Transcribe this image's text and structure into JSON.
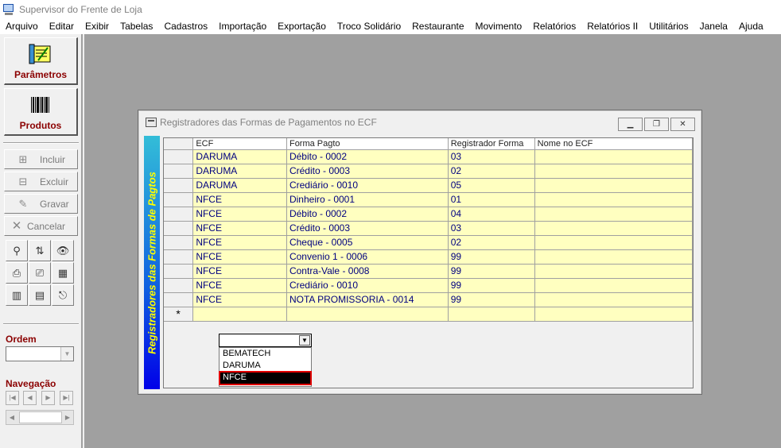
{
  "window": {
    "title": "Supervisor do Frente de Loja"
  },
  "menu": [
    "Arquivo",
    "Editar",
    "Exibir",
    "Tabelas",
    "Cadastros",
    "Importação",
    "Exportação",
    "Troco Solidário",
    "Restaurante",
    "Movimento",
    "Relatórios",
    "Relatórios II",
    "Utilitários",
    "Janela",
    "Ajuda"
  ],
  "toolbar": {
    "parametros": "Parâmetros",
    "produtos": "Produtos",
    "incluir": "Incluir",
    "excluir": "Excluir",
    "gravar": "Gravar",
    "cancelar": "Cancelar",
    "ordem_label": "Ordem",
    "navegacao_label": "Navegação"
  },
  "child": {
    "title": "Registradores das Formas de Pagamentos no ECF",
    "banner": "Registradores das Formas de Pagtos"
  },
  "grid": {
    "headers": [
      "ECF",
      "Forma Pagto",
      "Registrador Forma",
      "Nome no ECF"
    ],
    "rows": [
      [
        "DARUMA",
        "Débito  -  0002",
        "03",
        ""
      ],
      [
        "DARUMA",
        "Crédito  -  0003",
        "02",
        ""
      ],
      [
        "DARUMA",
        "Crediário  -  0010",
        "05",
        ""
      ],
      [
        "NFCE",
        "Dinheiro  -  0001",
        "01",
        ""
      ],
      [
        "NFCE",
        "Débito  -  0002",
        "04",
        ""
      ],
      [
        "NFCE",
        "Crédito  -  0003",
        "03",
        ""
      ],
      [
        "NFCE",
        "Cheque  -  0005",
        "02",
        ""
      ],
      [
        "NFCE",
        "Convenio 1  -  0006",
        "99",
        ""
      ],
      [
        "NFCE",
        "Contra-Vale  -  0008",
        "99",
        ""
      ],
      [
        "NFCE",
        "Crediário  -  0010",
        "99",
        ""
      ],
      [
        "NFCE",
        "NOTA PROMISSORIA  -  0014",
        "99",
        ""
      ]
    ],
    "new_row_marker": "*"
  },
  "dropdown": {
    "options": [
      "BEMATECH",
      "DARUMA",
      "NFCE"
    ],
    "selected": "NFCE"
  }
}
